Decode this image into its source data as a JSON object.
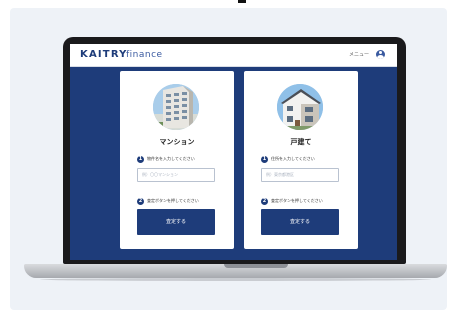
{
  "app": {
    "brand": "KAITRY",
    "brand_sub": "finance",
    "menu_label": "メニュー",
    "user_icon": "user-icon"
  },
  "cards": [
    {
      "title": "マンション",
      "step1_label": "物件名を入力してください",
      "input_placeholder": "例）〇〇マンション",
      "step2_label": "査定ボタンを押してください",
      "button_label": "査定する"
    },
    {
      "title": "戸建て",
      "step1_label": "住所を入力してください",
      "input_placeholder": "例）東京都港区",
      "step2_label": "査定ボタンを押してください",
      "button_label": "査定する"
    }
  ],
  "steps": [
    "1",
    "2"
  ],
  "colors": {
    "primary": "#1e3c7a",
    "card": "#ffffff",
    "header": "#ffffff"
  }
}
